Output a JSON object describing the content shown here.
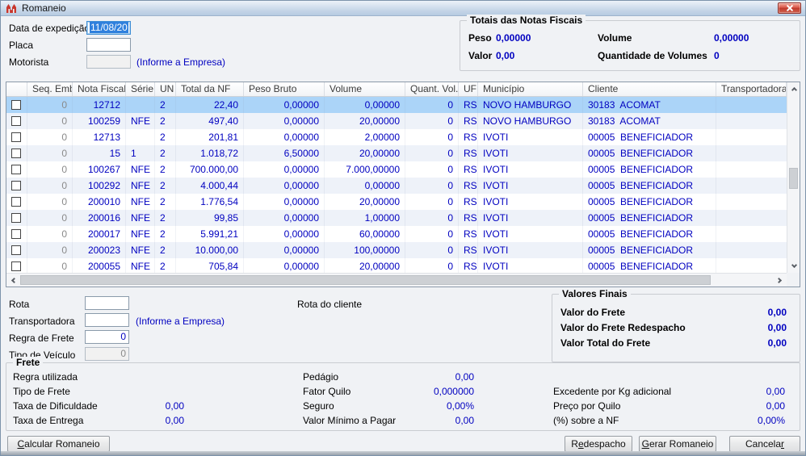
{
  "window": {
    "title": "Romaneio"
  },
  "theme": {
    "value_color": "#0000c0",
    "selected_row_bg": "#abd4f8",
    "alt_row_bg": "#eef2f9",
    "titlebar_close": "#bf3a2b"
  },
  "header_form": {
    "date_label": "Data de expedição",
    "date_value": "11/08/20",
    "placa_label": "Placa",
    "placa_value": "",
    "motorista_label": "Motorista",
    "motorista_value": "",
    "motorista_hint": "(Informe a Empresa)"
  },
  "totals": {
    "title": "Totais das Notas Fiscais",
    "peso_label": "Peso",
    "peso_value": "0,00000",
    "volume_label": "Volume",
    "volume_value": "0,00000",
    "valor_label": "Valor",
    "valor_value": "0,00",
    "qty_label": "Quantidade de Volumes",
    "qty_value": "0"
  },
  "grid": {
    "columns": {
      "cb": "",
      "seq": "Seq. Emb.",
      "nf": "Nota Fiscal",
      "serie": "Série",
      "un": "UN",
      "total": "Total da NF",
      "peso": "Peso Bruto",
      "volume": "Volume",
      "qvol": "Quant. Vol.",
      "uf": "UF",
      "municipio": "Município",
      "cliente": "Cliente",
      "transp": "Transportadora"
    },
    "rows": [
      {
        "seq": "0",
        "nf": "12712",
        "serie": "",
        "un": "2",
        "total": "22,40",
        "peso": "0,00000",
        "volume": "0,00000",
        "qvol": "0",
        "uf": "RS",
        "municipio": "NOVO HAMBURGO",
        "cliente": "30183  ACOMAT",
        "transp": "",
        "selected": true
      },
      {
        "seq": "0",
        "nf": "100259",
        "serie": "NFE",
        "un": "2",
        "total": "497,40",
        "peso": "0,00000",
        "volume": "20,00000",
        "qvol": "0",
        "uf": "RS",
        "municipio": "NOVO HAMBURGO",
        "cliente": "30183  ACOMAT",
        "transp": ""
      },
      {
        "seq": "0",
        "nf": "12713",
        "serie": "",
        "un": "2",
        "total": "201,81",
        "peso": "0,00000",
        "volume": "2,00000",
        "qvol": "0",
        "uf": "RS",
        "municipio": "IVOTI",
        "cliente": "00005  BENEFICIADOR",
        "transp": ""
      },
      {
        "seq": "0",
        "nf": "15",
        "serie": "1",
        "un": "2",
        "total": "1.018,72",
        "peso": "6,50000",
        "volume": "20,00000",
        "qvol": "0",
        "uf": "RS",
        "municipio": "IVOTI",
        "cliente": "00005  BENEFICIADOR",
        "transp": ""
      },
      {
        "seq": "0",
        "nf": "100267",
        "serie": "NFE",
        "un": "2",
        "total": "700.000,00",
        "peso": "0,00000",
        "volume": "7.000,00000",
        "qvol": "0",
        "uf": "RS",
        "municipio": "IVOTI",
        "cliente": "00005  BENEFICIADOR",
        "transp": ""
      },
      {
        "seq": "0",
        "nf": "100292",
        "serie": "NFE",
        "un": "2",
        "total": "4.000,44",
        "peso": "0,00000",
        "volume": "0,00000",
        "qvol": "0",
        "uf": "RS",
        "municipio": "IVOTI",
        "cliente": "00005  BENEFICIADOR",
        "transp": ""
      },
      {
        "seq": "0",
        "nf": "200010",
        "serie": "NFE",
        "un": "2",
        "total": "1.776,54",
        "peso": "0,00000",
        "volume": "20,00000",
        "qvol": "0",
        "uf": "RS",
        "municipio": "IVOTI",
        "cliente": "00005  BENEFICIADOR",
        "transp": ""
      },
      {
        "seq": "0",
        "nf": "200016",
        "serie": "NFE",
        "un": "2",
        "total": "99,85",
        "peso": "0,00000",
        "volume": "1,00000",
        "qvol": "0",
        "uf": "RS",
        "municipio": "IVOTI",
        "cliente": "00005  BENEFICIADOR",
        "transp": ""
      },
      {
        "seq": "0",
        "nf": "200017",
        "serie": "NFE",
        "un": "2",
        "total": "5.991,21",
        "peso": "0,00000",
        "volume": "60,00000",
        "qvol": "0",
        "uf": "RS",
        "municipio": "IVOTI",
        "cliente": "00005  BENEFICIADOR",
        "transp": ""
      },
      {
        "seq": "0",
        "nf": "200023",
        "serie": "NFE",
        "un": "2",
        "total": "10.000,00",
        "peso": "0,00000",
        "volume": "100,00000",
        "qvol": "0",
        "uf": "RS",
        "municipio": "IVOTI",
        "cliente": "00005  BENEFICIADOR",
        "transp": ""
      },
      {
        "seq": "0",
        "nf": "200055",
        "serie": "NFE",
        "un": "2",
        "total": "705,84",
        "peso": "0,00000",
        "volume": "20,00000",
        "qvol": "0",
        "uf": "RS",
        "municipio": "IVOTI",
        "cliente": "00005  BENEFICIADOR",
        "transp": ""
      }
    ]
  },
  "mid_form": {
    "rota_label": "Rota",
    "rota_value": "",
    "rota_cliente_label": "Rota do cliente",
    "transportadora_label": "Transportadora",
    "transportadora_value": "",
    "transportadora_hint": "(Informe a Empresa)",
    "regra_frete_label": "Regra de Frete",
    "regra_frete_value": "0",
    "tipo_veiculo_label": "Tipo de Veículo",
    "tipo_veiculo_value": "0"
  },
  "valores_finais": {
    "title": "Valores Finais",
    "rows": [
      {
        "label": "Valor do Frete",
        "value": "0,00"
      },
      {
        "label": "Valor do Frete Redespacho",
        "value": "0,00"
      },
      {
        "label": "Valor Total do Frete",
        "value": "0,00"
      }
    ]
  },
  "frete": {
    "title": "Frete",
    "col1": [
      {
        "label": "Regra utilizada",
        "value": ""
      },
      {
        "label": "Tipo de Frete",
        "value": ""
      },
      {
        "label": "Taxa de Dificuldade",
        "value": "0,00"
      },
      {
        "label": "Taxa de Entrega",
        "value": "0,00"
      }
    ],
    "col2": [
      {
        "label": "Pedágio",
        "value": "0,00"
      },
      {
        "label": "Fator Quilo",
        "value": "0,000000"
      },
      {
        "label": "Seguro",
        "value": "0,00%"
      },
      {
        "label": "Valor Mínimo a Pagar",
        "value": "0,00"
      }
    ],
    "col3": [
      {
        "label": "Excedente por Kg adicional",
        "value": "0,00"
      },
      {
        "label": "Preço por Quilo",
        "value": "0,00"
      },
      {
        "label": "(%) sobre a NF",
        "value": "0,00%"
      }
    ]
  },
  "buttons": {
    "calcular": "Calcular Romaneio",
    "redespacho": "Redespacho",
    "gerar": "Gerar Romaneio",
    "cancelar": "Cancelar"
  }
}
